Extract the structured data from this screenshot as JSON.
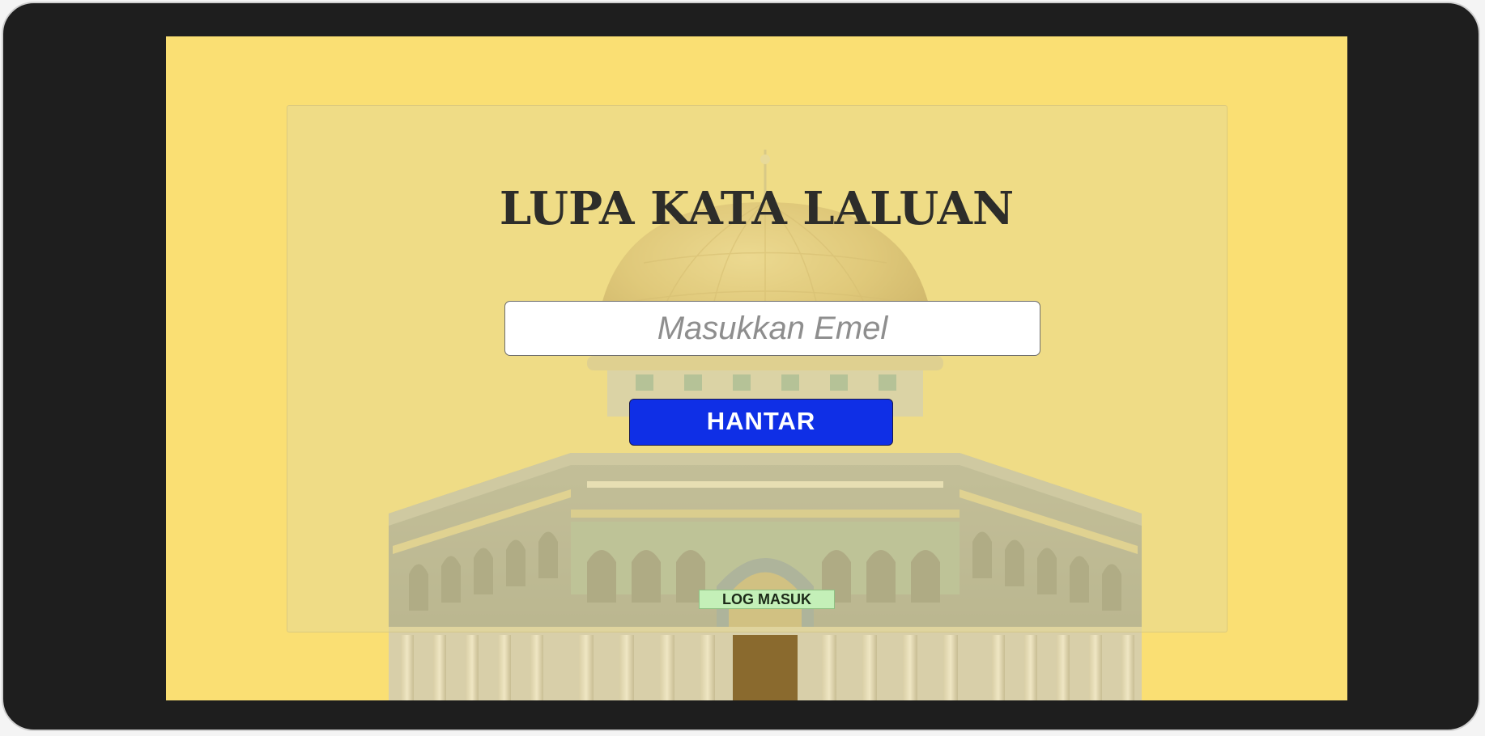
{
  "page": {
    "title": "LUPA KATA LALUAN"
  },
  "form": {
    "email_placeholder": "Masukkan Emel",
    "email_value": "",
    "submit_label": "HANTAR",
    "login_label": "LOG MASUK"
  },
  "background": {
    "illustration": "mosque-dome-illustration"
  },
  "colors": {
    "frame": "#1e1e1e",
    "screen_background": "#fadf73",
    "submit_button": "#0f2fe6",
    "login_button": "#c4f0b8",
    "title_text": "#2d2d2a"
  }
}
